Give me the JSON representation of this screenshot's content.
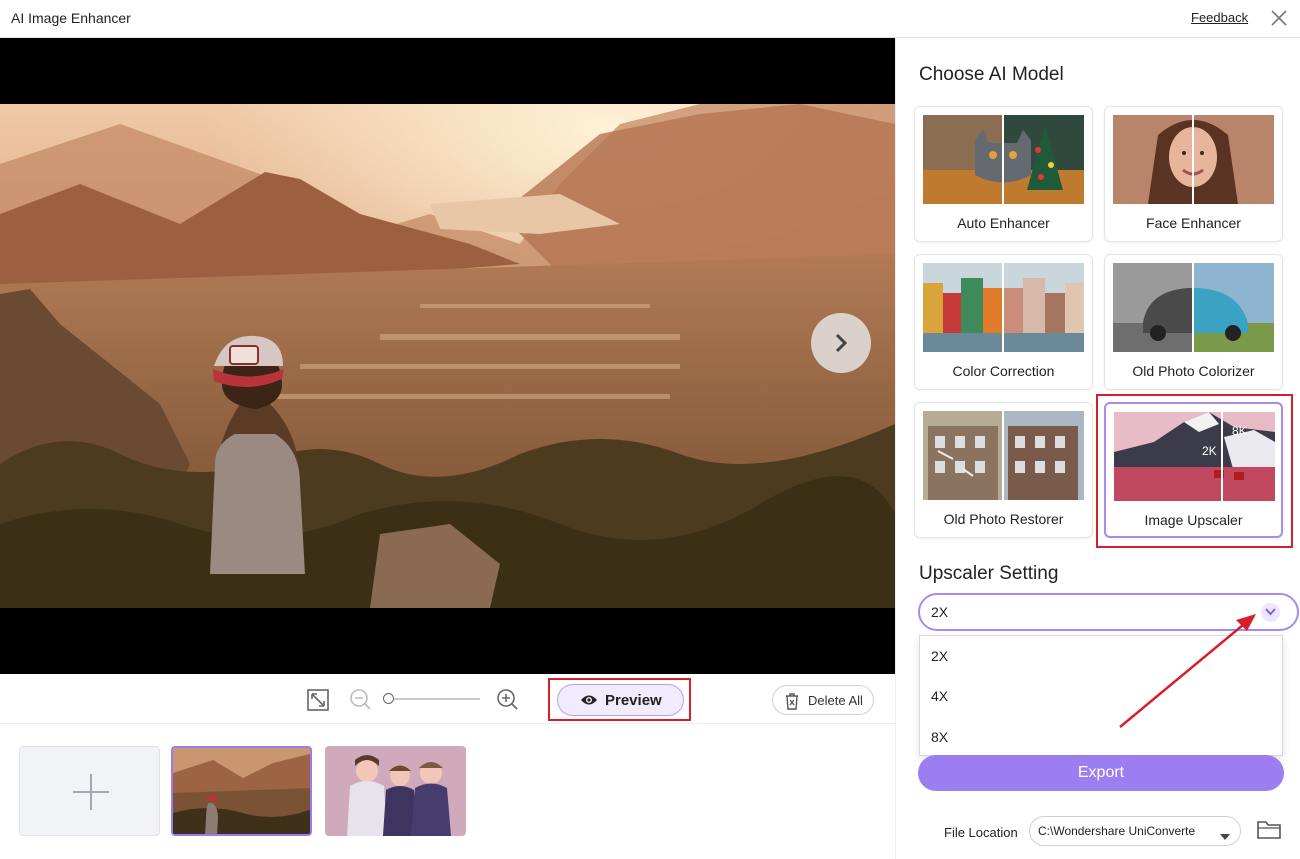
{
  "window": {
    "title": "AI Image Enhancer",
    "feedback": "Feedback"
  },
  "toolbar": {
    "preview_label": "Preview",
    "delete_all_label": "Delete All",
    "zoom_level": 0.0
  },
  "panel": {
    "model_heading": "Choose AI Model",
    "models": [
      {
        "label": "Auto Enhancer"
      },
      {
        "label": "Face Enhancer"
      },
      {
        "label": "Color Correction"
      },
      {
        "label": "Old Photo Colorizer"
      },
      {
        "label": "Old Photo Restorer"
      },
      {
        "label": "Image Upscaler",
        "selected": true,
        "overlay_labels": [
          "2K",
          "8K"
        ]
      }
    ],
    "setting_heading": "Upscaler Setting",
    "upscale_value": "2X",
    "upscale_options": [
      "2X",
      "4X",
      "8X"
    ],
    "export_label": "Export",
    "file_location_label": "File Location",
    "file_location_value": "C:\\Wondershare UniConverte"
  },
  "colors": {
    "accent": "#9d7ef2",
    "highlight": "#d51f2a"
  }
}
